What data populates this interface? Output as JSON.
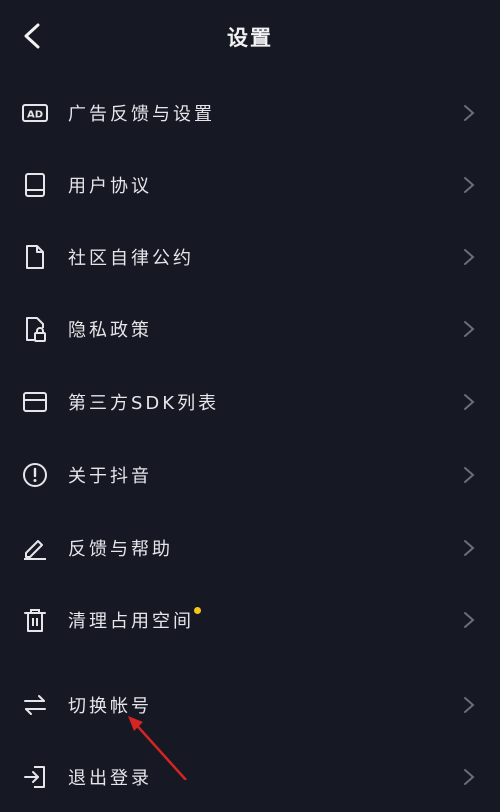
{
  "header": {
    "title": "设置"
  },
  "settings": [
    {
      "label": "广告反馈与设置",
      "icon": "ad-icon"
    },
    {
      "label": "用户协议",
      "icon": "book-icon"
    },
    {
      "label": "社区自律公约",
      "icon": "document-icon"
    },
    {
      "label": "隐私政策",
      "icon": "lock-document-icon"
    },
    {
      "label": "第三方SDK列表",
      "icon": "box-icon"
    },
    {
      "label": "关于抖音",
      "icon": "info-icon"
    },
    {
      "label": "反馈与帮助",
      "icon": "pen-icon"
    },
    {
      "label": "清理占用空间",
      "icon": "trash-icon",
      "badge": true
    },
    {
      "label": "切换帐号",
      "icon": "swap-icon"
    },
    {
      "label": "退出登录",
      "icon": "logout-icon"
    }
  ],
  "colors": {
    "background": "#161823",
    "text": "#e6e6ea",
    "chevron": "#6b6e7a",
    "badge": "#f5c518",
    "annotation": "#d42424"
  }
}
